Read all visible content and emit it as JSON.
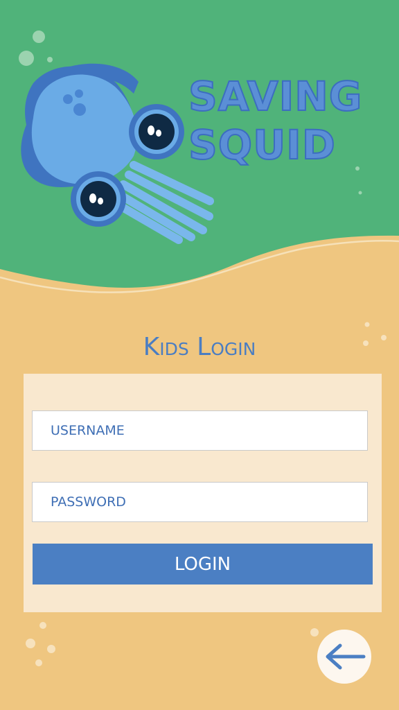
{
  "app": {
    "title_line1": "SAVING",
    "title_line2": "SQUID"
  },
  "login": {
    "heading": "Kids Login",
    "username_placeholder": "USERNAME",
    "password_placeholder": "PASSWORD",
    "button_label": "LOGIN"
  },
  "nav": {
    "back_icon": "arrow-left-icon"
  },
  "colors": {
    "sea_green": "#50b37a",
    "sand": "#efc680",
    "panel": "#f9e8cf",
    "accent_blue": "#4b7fc3",
    "squid_blue": "#6aabe6"
  }
}
